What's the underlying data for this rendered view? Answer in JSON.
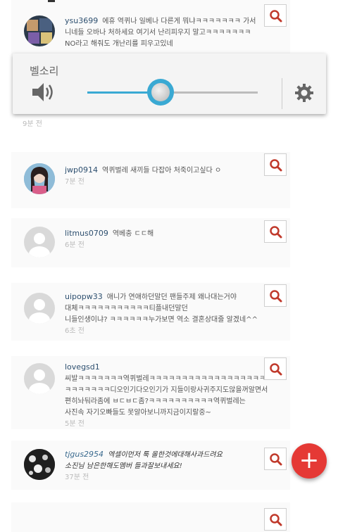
{
  "volume_dialog": {
    "title": "벨소리",
    "level": 0.43,
    "speaker_icon": "speaker-icon",
    "settings_icon": "gear-icon",
    "accent_color": "#3aa9d3"
  },
  "comments": [
    {
      "user": "ysu3699",
      "lines": [
        "에휴 역퀴나 일베나 다른게 뭐냐ㅋㅋㅋㅋㅋㅋㅋ 가서",
        "니네들 오바나 처하세요 여기서 난리피우지 말고ㅋㅋㅋㅋㅋㅋㅋ",
        "NO라고 해줘도 개난리를 피우고있네"
      ],
      "time": "9분 전",
      "avatar": "photo"
    },
    {
      "user": "jwp0914",
      "lines": [
        "역퀴벌레 새끼들 다잡아 처죽이고싶다 ㅇ"
      ],
      "time": "7분 전",
      "avatar": "photo"
    },
    {
      "user": "litmus0709",
      "lines": [
        "역베충 ㄷㄷ해"
      ],
      "time": "6분 전",
      "avatar": "default"
    },
    {
      "user": "uipopw33",
      "lines": [
        "애니가 연애하던말던 팬들주제 왜나대는거야",
        "대체ㅋㅋㅋㅋㅋㅋㅋㅋㅋㅋㅋ티플내던말던",
        "니들인생이냐? ㅋㅋㅋㅋㅋㅋ누가보면 역소 결혼상대줄 알겠네^^"
      ],
      "time": "6초 전",
      "avatar": "default"
    },
    {
      "user": "lovegsd1",
      "lines": [
        "씨발ㅋㅋㅋㅋㅋㅋㅋ역퀴벌레ㅋㅋㅋㅋㅋㅋㅋㅋㅋㅋㅋㅋㅋㅋㅋㅋㅋㅋㅋㅋ",
        "ㅋㅋㅋㅋㅋㅋㅋ디오인기다오인기가 지들이랑사귀주지도않을꺼알면서",
        "편히놔둬라좀에 ㅂㄷㅂㄷ좀?ㅋㅋㅋㅋㅋㅋㅋㅋㅋㅋ역퀴벌레는",
        "사진속 자기오빠들도 못알아보니까지금이지랄중~"
      ],
      "time": "5분 전",
      "avatar": "default"
    },
    {
      "user": "tjgus2954",
      "lines": [
        "엑셀이먼저 툭 올한것에대해사과드려요",
        "소진님 남은한해도멤버 들과잘보내세요!"
      ],
      "time": "37분 전",
      "avatar": "photo"
    }
  ],
  "search_icon": "search-icon",
  "fab": {
    "label": "+",
    "icon": "plus-icon",
    "color": "#e53935"
  }
}
